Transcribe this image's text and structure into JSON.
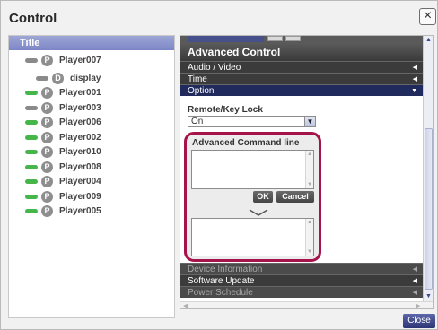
{
  "dialog": {
    "title": "Control",
    "close_glyph": "×",
    "close_button": "Close"
  },
  "tree": {
    "header": "Title",
    "nodes": [
      {
        "label": "Player007",
        "badge": "P",
        "status_color": "#8a8a8a",
        "badge_color": "#8e8e8e"
      },
      {
        "label": "display",
        "badge": "D",
        "status_color": "#8a8a8a",
        "badge_color": "#8e8e8e"
      },
      {
        "label": "Player001",
        "badge": "P",
        "status_color": "#47b64a",
        "badge_color": "#8e8e8e"
      },
      {
        "label": "Player003",
        "badge": "P",
        "status_color": "#8a8a8a",
        "badge_color": "#8e8e8e"
      },
      {
        "label": "Player006",
        "badge": "P",
        "status_color": "#47b64a",
        "badge_color": "#8e8e8e"
      },
      {
        "label": "Player002",
        "badge": "P",
        "status_color": "#47b64a",
        "badge_color": "#8e8e8e"
      },
      {
        "label": "Player010",
        "badge": "P",
        "status_color": "#47b64a",
        "badge_color": "#8e8e8e"
      },
      {
        "label": "Player008",
        "badge": "P",
        "status_color": "#47b64a",
        "badge_color": "#8e8e8e"
      },
      {
        "label": "Player004",
        "badge": "P",
        "status_color": "#47b64a",
        "badge_color": "#8e8e8e"
      },
      {
        "label": "Player009",
        "badge": "P",
        "status_color": "#47b64a",
        "badge_color": "#8e8e8e"
      },
      {
        "label": "Player005",
        "badge": "P",
        "status_color": "#47b64a",
        "badge_color": "#8e8e8e"
      }
    ]
  },
  "panel": {
    "header": "Advanced Control",
    "menu": [
      {
        "label": "Audio / Video",
        "arrow": "◀"
      },
      {
        "label": "Time",
        "arrow": "◀"
      },
      {
        "label": "Option",
        "arrow": "▼"
      }
    ],
    "remote_key_lock": {
      "label": "Remote/Key Lock",
      "value": "On"
    },
    "advanced_command": {
      "label": "Advanced Command line",
      "ok": "OK",
      "cancel": "Cancel"
    },
    "bottom_menu": [
      {
        "label": "Device Information",
        "arrow": "◀"
      },
      {
        "label": "Software Update",
        "arrow": "◀"
      },
      {
        "label": "Power Schedule",
        "arrow": "◀"
      }
    ]
  },
  "colors": {
    "accent": "#2b3474",
    "highlight": "#a5134a",
    "selected_row": "#202a5c"
  }
}
